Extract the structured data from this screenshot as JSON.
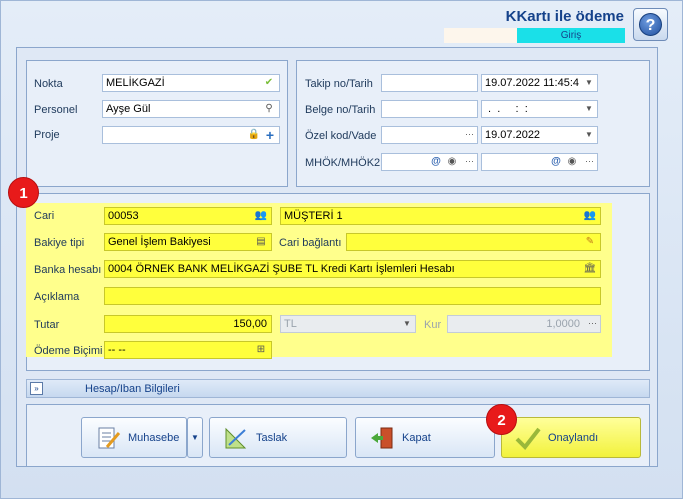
{
  "header": {
    "title": "KKartı ile ödeme",
    "mode_label": "Giriş"
  },
  "left_group": {
    "nokta": {
      "label": "Nokta",
      "value": "MELİKGAZİ"
    },
    "personel": {
      "label": "Personel",
      "value": "Ayşe Gül"
    },
    "proje": {
      "label": "Proje",
      "value": ""
    }
  },
  "right_group": {
    "takip": {
      "label": "Takip no/Tarih",
      "no": "",
      "date": "19.07.2022 11:45:4"
    },
    "belge": {
      "label": "Belge no/Tarih",
      "no": "",
      "date": " .  .     :  :"
    },
    "ozel": {
      "label": "Özel kod/Vade",
      "code": "",
      "date": "19.07.2022"
    },
    "mhok": {
      "label": "MHÖK/MHÖK2",
      "v1": "",
      "v2": ""
    }
  },
  "main_group": {
    "cari": {
      "label": "Cari",
      "code": "00053",
      "name": "MÜŞTERİ 1"
    },
    "bakiye_tipi": {
      "label": "Bakiye tipi",
      "value": "Genel İşlem Bakiyesi"
    },
    "cari_baglanti": {
      "label": "Cari bağlantı",
      "value": ""
    },
    "banka_hesabi": {
      "label": "Banka hesabı",
      "value": "0004 ÖRNEK BANK MELİKGAZİ ŞUBE TL Kredi Kartı İşlemleri Hesabı"
    },
    "aciklama": {
      "label": "Açıklama",
      "value": ""
    },
    "tutar": {
      "label": "Tutar",
      "value": "150,00",
      "currency": "TL"
    },
    "kur": {
      "label": "Kur",
      "value": "1,0000"
    },
    "odeme_bicimi": {
      "label": "Ödeme Biçimi",
      "value": "-- --"
    }
  },
  "collapse": {
    "label": "Hesap/Iban Bilgileri"
  },
  "buttons": {
    "muhasebe": "Muhasebe",
    "taslak": "Taslak",
    "kapat": "Kapat",
    "onaylandi": "Onaylandı"
  },
  "badges": {
    "one": "1",
    "two": "2"
  },
  "colors": {
    "highlight": "#ffff8c",
    "field_yellow": "#ffff3c",
    "badge_red": "#e81a1a",
    "accent_cyan": "#1ae0e8"
  }
}
